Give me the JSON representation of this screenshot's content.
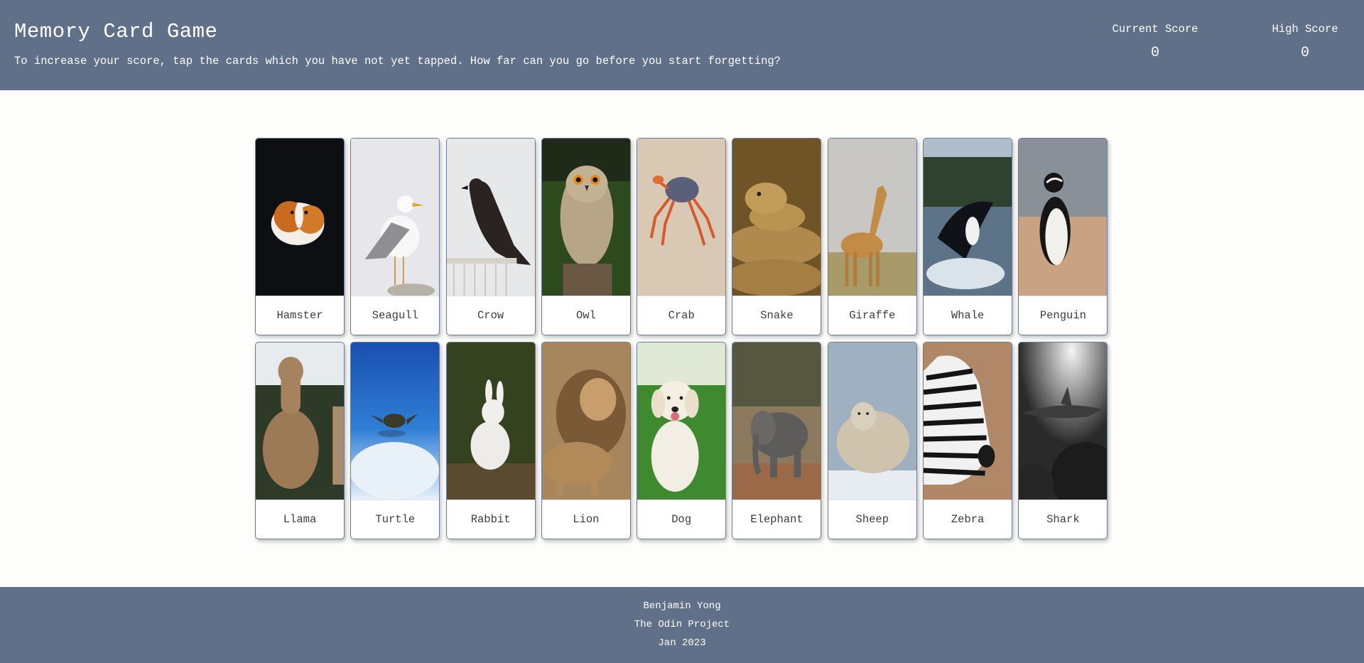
{
  "header": {
    "title": "Memory Card Game",
    "subtitle": "To increase your score, tap the cards which you have not yet tapped. How far can you go before you start forgetting?",
    "current_score_label": "Current Score",
    "current_score": "0",
    "high_score_label": "High Score",
    "high_score": "0"
  },
  "cards": [
    {
      "label": "Hamster",
      "icon": "hamster-photo"
    },
    {
      "label": "Seagull",
      "icon": "seagull-photo"
    },
    {
      "label": "Crow",
      "icon": "crow-photo"
    },
    {
      "label": "Owl",
      "icon": "owl-photo"
    },
    {
      "label": "Crab",
      "icon": "crab-photo"
    },
    {
      "label": "Snake",
      "icon": "snake-photo"
    },
    {
      "label": "Giraffe",
      "icon": "giraffe-photo"
    },
    {
      "label": "Whale",
      "icon": "whale-photo"
    },
    {
      "label": "Penguin",
      "icon": "penguin-photo"
    },
    {
      "label": "Llama",
      "icon": "llama-photo"
    },
    {
      "label": "Turtle",
      "icon": "turtle-photo"
    },
    {
      "label": "Rabbit",
      "icon": "rabbit-photo"
    },
    {
      "label": "Lion",
      "icon": "lion-photo"
    },
    {
      "label": "Dog",
      "icon": "dog-photo"
    },
    {
      "label": "Elephant",
      "icon": "elephant-photo"
    },
    {
      "label": "Sheep",
      "icon": "sheep-photo"
    },
    {
      "label": "Zebra",
      "icon": "zebra-photo"
    },
    {
      "label": "Shark",
      "icon": "shark-photo"
    }
  ],
  "footer": {
    "author": "Benjamin Yong",
    "project": "The Odin Project",
    "date": "Jan 2023"
  },
  "colors": {
    "bar": "#5f7088",
    "background": "#fdfdfb",
    "card_border": "#6b7a96"
  }
}
